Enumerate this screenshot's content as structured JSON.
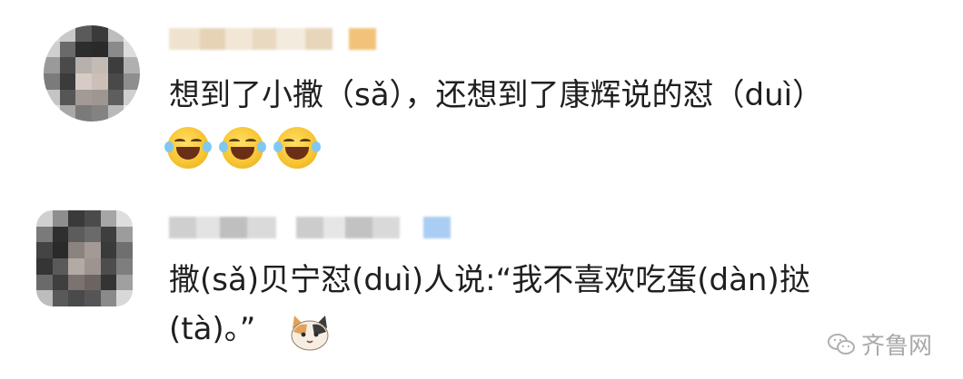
{
  "comments": [
    {
      "text": "想到了小撒（sǎ），还想到了康辉说的怼（duì）",
      "emojis": [
        "laughing-crying-emoji",
        "laughing-crying-emoji",
        "laughing-crying-emoji"
      ]
    },
    {
      "text_line1": "撒(sǎ)贝宁怼(duì)人说:“我不喜欢吃蛋(dàn)挞",
      "text_line2": "(tà)。”",
      "emoji": "cat-face-emoji"
    }
  ],
  "watermark": {
    "text": "齐鲁网",
    "icon": "wechat-icon"
  }
}
